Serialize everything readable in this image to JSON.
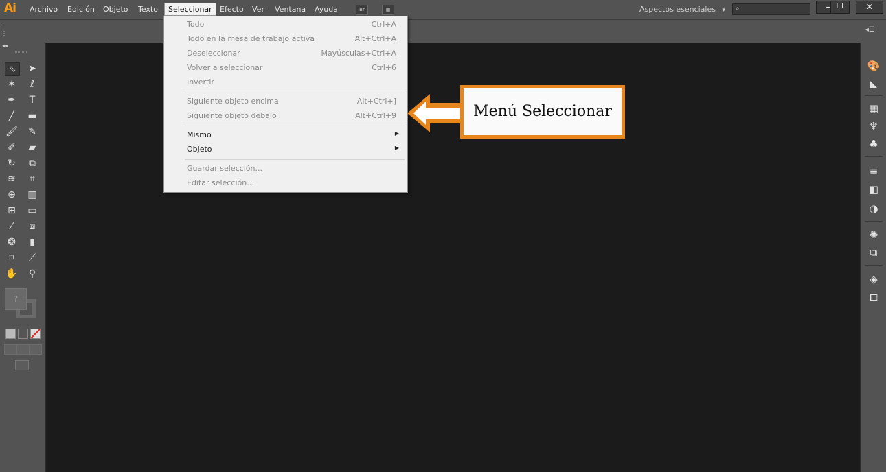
{
  "app": {
    "logo": "Ai"
  },
  "menubar": {
    "items": [
      "Archivo",
      "Edición",
      "Objeto",
      "Texto",
      "Seleccionar",
      "Efecto",
      "Ver",
      "Ventana",
      "Ayuda"
    ],
    "active_item": "Seleccionar",
    "bridge_icon": "Br",
    "workspace": "Aspectos esenciales",
    "workspace_caret": "▾",
    "window_buttons": [
      "minimize",
      "restore",
      "close"
    ]
  },
  "select_menu": {
    "groups": [
      [
        {
          "label": "Todo",
          "shortcut": "Ctrl+A",
          "enabled": false
        },
        {
          "label": "Todo en la mesa de trabajo activa",
          "shortcut": "Alt+Ctrl+A",
          "enabled": false
        },
        {
          "label": "Deseleccionar",
          "shortcut": "Mayúsculas+Ctrl+A",
          "enabled": false
        },
        {
          "label": "Volver a seleccionar",
          "shortcut": "Ctrl+6",
          "enabled": false
        },
        {
          "label": "Invertir",
          "shortcut": "",
          "enabled": false
        }
      ],
      [
        {
          "label": "Siguiente objeto encima",
          "shortcut": "Alt+Ctrl+]",
          "enabled": false
        },
        {
          "label": "Siguiente objeto debajo",
          "shortcut": "Alt+Ctrl+9",
          "enabled": false
        }
      ],
      [
        {
          "label": "Mismo",
          "shortcut": "",
          "enabled": true,
          "submenu": true
        },
        {
          "label": "Objeto",
          "shortcut": "",
          "enabled": true,
          "submenu": true
        }
      ],
      [
        {
          "label": "Guardar selección...",
          "shortcut": "",
          "enabled": false
        },
        {
          "label": "Editar selección...",
          "shortcut": "",
          "enabled": false
        }
      ]
    ]
  },
  "callout": {
    "text": "Menú Seleccionar",
    "border_color": "#e8861e"
  },
  "tools_panel": {
    "tool_icons": [
      "selection-arrow-icon",
      "direct-selection-icon",
      "magic-wand-icon",
      "lasso-icon",
      "pen-icon",
      "type-icon",
      "line-icon",
      "rectangle-icon",
      "paintbrush-icon",
      "pencil-icon",
      "blob-brush-icon",
      "eraser-icon",
      "rotate-icon",
      "scale-icon",
      "width-icon",
      "free-transform-icon",
      "shape-builder-icon",
      "perspective-grid-icon",
      "mesh-icon",
      "gradient-icon",
      "eyedropper-icon",
      "blend-icon",
      "symbol-sprayer-icon",
      "column-graph-icon",
      "artboard-icon",
      "slice-icon",
      "hand-icon",
      "zoom-icon"
    ],
    "fill_placeholder": "?"
  },
  "colors": {
    "accent": "#e8861e",
    "logo": "#f49b1a",
    "ui_gray": "#535353",
    "canvas": "#1b1b1b"
  }
}
